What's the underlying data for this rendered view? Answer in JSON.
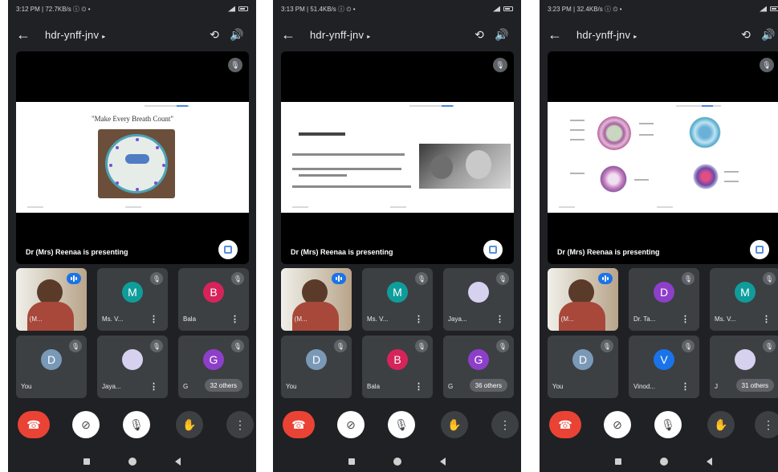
{
  "screens": [
    {
      "status_time": "3:12 PM | 72.7KB/s ⓘ ⏲ •",
      "meeting_code": "hdr-ynff-jnv",
      "presenting_text": "Dr (Mrs) Reenaa is presenting",
      "slide_title": "\"Make Every Breath Count\"",
      "tiles": [
        {
          "type": "self",
          "name": "Dr (M...",
          "has_menu": false
        },
        {
          "type": "avatar",
          "initial": "M",
          "name": "Ms. V...",
          "color": "#0f9d9b",
          "has_menu": true
        },
        {
          "type": "avatar",
          "initial": "B",
          "name": "Bala",
          "color": "#d6245a",
          "has_menu": true
        },
        {
          "type": "avatar",
          "initial": "D",
          "name": "You",
          "color": "#7a99b7",
          "has_menu": false
        },
        {
          "type": "avatar",
          "initial": "J",
          "name": "Jaya...",
          "color": "#d7d1f0",
          "has_menu": true
        },
        {
          "type": "avatar",
          "initial": "G",
          "name": "G",
          "color": "#8e3fc9",
          "others": "32 others"
        }
      ]
    },
    {
      "status_time": "3:13 PM | 51.4KB/s ⓘ ⏲ •",
      "meeting_code": "hdr-ynff-jnv",
      "presenting_text": "Dr (Mrs) Reenaa is presenting",
      "tiles": [
        {
          "type": "self",
          "name": "Dr (M...",
          "has_menu": false
        },
        {
          "type": "avatar",
          "initial": "M",
          "name": "Ms. V...",
          "color": "#0f9d9b",
          "has_menu": true
        },
        {
          "type": "avatar",
          "initial": "J",
          "name": "Jaya...",
          "color": "#d7d1f0",
          "has_menu": true
        },
        {
          "type": "avatar",
          "initial": "D",
          "name": "You",
          "color": "#7a99b7",
          "has_menu": false
        },
        {
          "type": "avatar",
          "initial": "B",
          "name": "Bala",
          "color": "#d6245a",
          "has_menu": true
        },
        {
          "type": "avatar",
          "initial": "G",
          "name": "G",
          "color": "#8e3fc9",
          "others": "36 others"
        }
      ]
    },
    {
      "status_time": "3:23 PM | 32.4KB/s ⓘ ⏲ •",
      "meeting_code": "hdr-ynff-jnv",
      "presenting_text": "Dr (Mrs) Reenaa is presenting",
      "tiles": [
        {
          "type": "self",
          "name": "Dr (M...",
          "has_menu": false
        },
        {
          "type": "avatar",
          "initial": "D",
          "name": "Dr. Ta...",
          "color": "#8e3fc9",
          "has_menu": true
        },
        {
          "type": "avatar",
          "initial": "M",
          "name": "Ms. V...",
          "color": "#0f9d9b",
          "has_menu": true
        },
        {
          "type": "avatar",
          "initial": "D",
          "name": "You",
          "color": "#7a99b7",
          "has_menu": false
        },
        {
          "type": "avatar",
          "initial": "V",
          "name": "Vinod...",
          "color": "#1a73e8",
          "has_menu": true
        },
        {
          "type": "avatar",
          "initial": "J",
          "name": "J",
          "color": "#d7d1f0",
          "others": "31 others"
        }
      ]
    }
  ],
  "icons": {
    "back": "←",
    "switch_camera": "⟲",
    "speaker": "🔊",
    "mic_off": "🎙",
    "end_call": "☎",
    "camera_off": "⊘",
    "raise_hand": "✋",
    "more": "⋮"
  },
  "colors": {
    "end_call": "#ea4335",
    "accent_blue": "#1a73e8",
    "tile_bg": "#3c4043",
    "app_bg": "#202124"
  }
}
